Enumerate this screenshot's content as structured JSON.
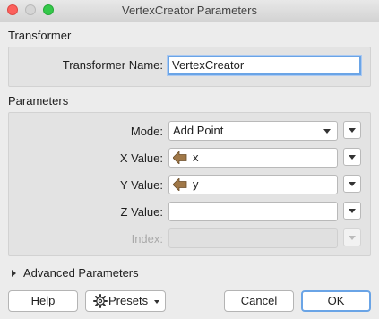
{
  "window": {
    "title": "VertexCreator Parameters"
  },
  "transformer_section": {
    "heading": "Transformer",
    "name_label": "Transformer Name:",
    "name_value": "VertexCreator"
  },
  "parameters_section": {
    "heading": "Parameters",
    "mode_label": "Mode:",
    "mode_value": "Add Point",
    "x_label": "X Value:",
    "x_value": "x",
    "y_label": "Y Value:",
    "y_value": "y",
    "z_label": "Z Value:",
    "z_value": "",
    "index_label": "Index:",
    "index_value": ""
  },
  "advanced": {
    "label": "Advanced Parameters"
  },
  "buttons": {
    "help": "Help",
    "presets": "Presets",
    "cancel": "Cancel",
    "ok": "OK"
  },
  "icons": {
    "attribute": "attribute-arrow-icon",
    "presets": "gear-icon"
  },
  "colors": {
    "focus": "#6aa4e6",
    "attribute_icon": "#a07848"
  }
}
